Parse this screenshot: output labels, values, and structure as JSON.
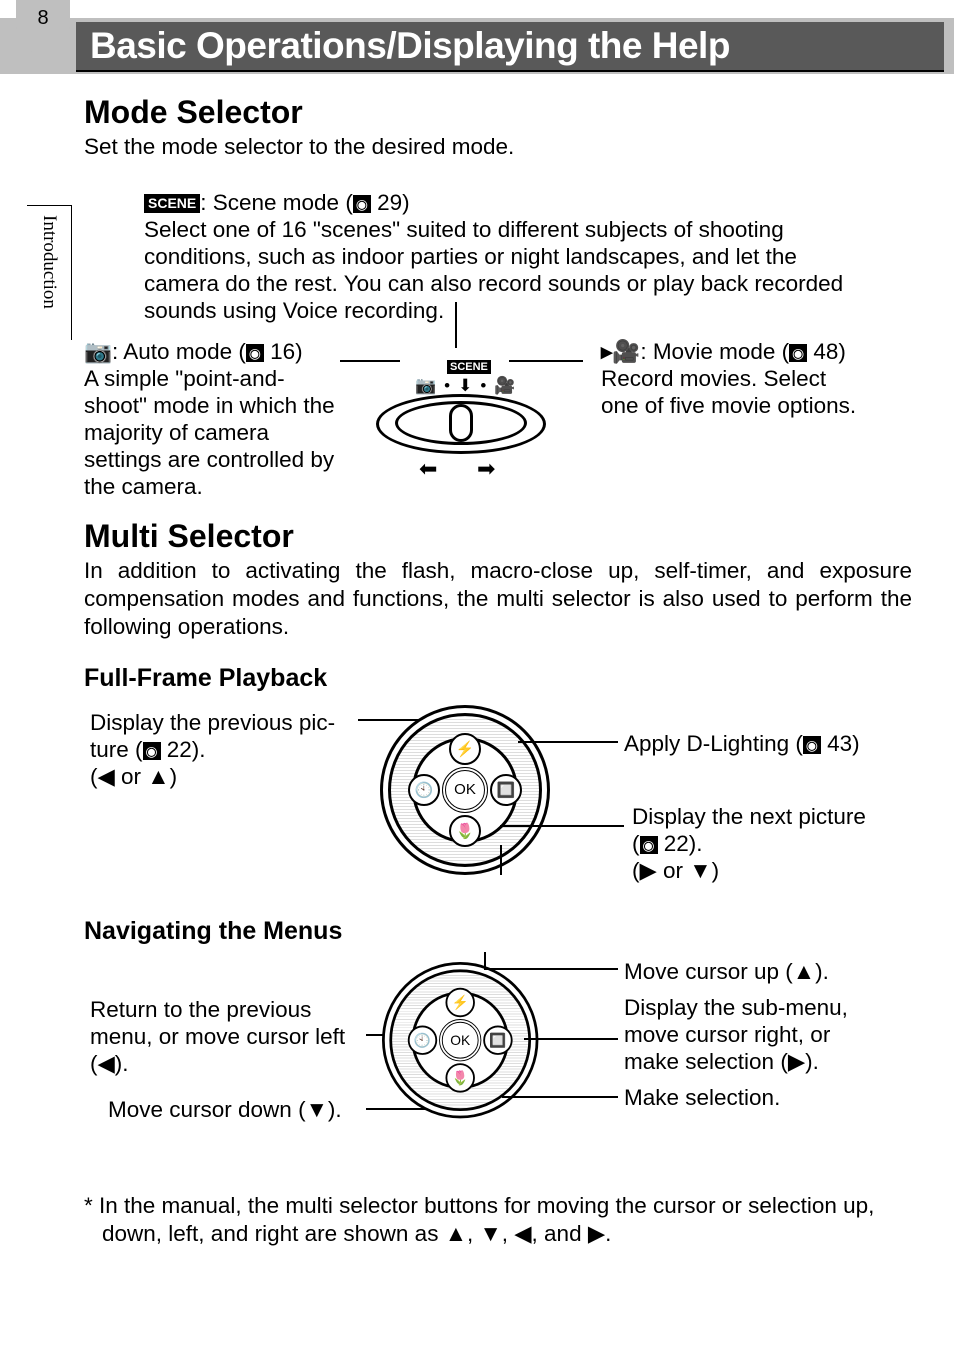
{
  "page_number": "8",
  "side_tab": "Introduction",
  "chapter_title": "Basic Operations/Displaying the Help",
  "mode_selector": {
    "heading": "Mode Selector",
    "intro": "Set the mode selector to the desired mode.",
    "scene": {
      "label": "SCENE",
      "title_part1": ": Scene mode (",
      "page": " 29)",
      "desc": "Select one of 16 \"scenes\" suited to different subjects of shooting conditions, such as indoor parties or night landscapes, and let the camera do the rest. You can also record sounds or play back recorded sounds using Voice recording."
    },
    "auto": {
      "title_part1": ": Auto mode (",
      "page": " 16)",
      "desc": "A simple \"point-and-shoot\" mode in which the majority of camera settings are controlled by the camera."
    },
    "movie": {
      "icon": "▸🎥",
      "title_part1": ": Movie mode (",
      "page": " 48)",
      "desc": "Record movies. Select one of five movie options."
    }
  },
  "multi_selector": {
    "heading": "Multi Selector",
    "intro": "In addition to activating the flash, macro-close up, self-timer, and exposure compensation modes and functions, the multi selector is also used to perform the following operations.",
    "playback": {
      "heading": "Full-Frame Playback",
      "prev_pic_part1": "Display the previous pic-",
      "prev_pic_part2": "ture (",
      "prev_pic_page": " 22).",
      "prev_pic_dir": "(◀ or ▲)",
      "dlight_part1": "Apply D-Lighting (",
      "dlight_page": " 43)",
      "next_part1": "Display the next picture",
      "next_part2": "(",
      "next_page": " 22).",
      "next_dir": "(▶ or ▼)"
    },
    "navigating": {
      "heading": "Navigating the Menus",
      "cursor_up": "Move cursor up (▲).",
      "submenu_l1": "Display the sub-menu,",
      "submenu_l2": "move cursor right, or",
      "submenu_l3": "make selection (▶).",
      "make_selection": "Make selection.",
      "return_l1": "Return to the previous",
      "return_l2": "menu, or move cursor left",
      "return_l3": "(◀).",
      "cursor_down": "Move cursor down (▼)."
    }
  },
  "dial_labels": {
    "ok": "OK",
    "flash": "⚡",
    "timer": "🕙",
    "macro": "🌷",
    "exp": "🔲"
  },
  "footnote": "* In the manual, the multi selector buttons for moving the cursor or selection up, down, left, and right are shown as ▲, ▼, ◀, and ▶."
}
